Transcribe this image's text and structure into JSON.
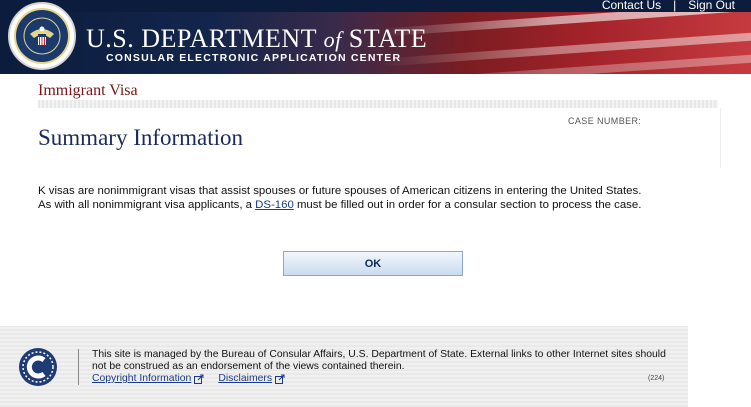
{
  "header": {
    "top_links": [
      "Contact Us",
      "Sign Out"
    ],
    "separator": "|",
    "title_part1": "U.S. DEPARTMENT",
    "title_of": "of",
    "title_part2": "STATE",
    "subtitle": "CONSULAR ELECTRONIC APPLICATION CENTER",
    "colors": {
      "navy": "#0b1c3d",
      "red": "#a3222a"
    }
  },
  "main": {
    "section_label": "Immigrant Visa",
    "case_number_label": "CASE NUMBER:",
    "case_number_value": "",
    "page_title": "Summary Information",
    "paragraph_line1": "K visas are nonimmigrant visas that assist spouses or future spouses of American citizens in entering the United States.",
    "paragraph_line2_before": "As with all nonimmigrant visa applicants, a ",
    "paragraph_link": "DS-160",
    "paragraph_line2_after": " must be filled out in order for a consular section to process the case.",
    "ok_button": "OK"
  },
  "footer": {
    "text": "This site is managed by the Bureau of Consular Affairs, U.S. Department of State. External links to other Internet sites should not be construed as an endorsement of the views contained therein.",
    "links": [
      "Copyright Information",
      "Disclaimers"
    ],
    "code": "(224)"
  }
}
